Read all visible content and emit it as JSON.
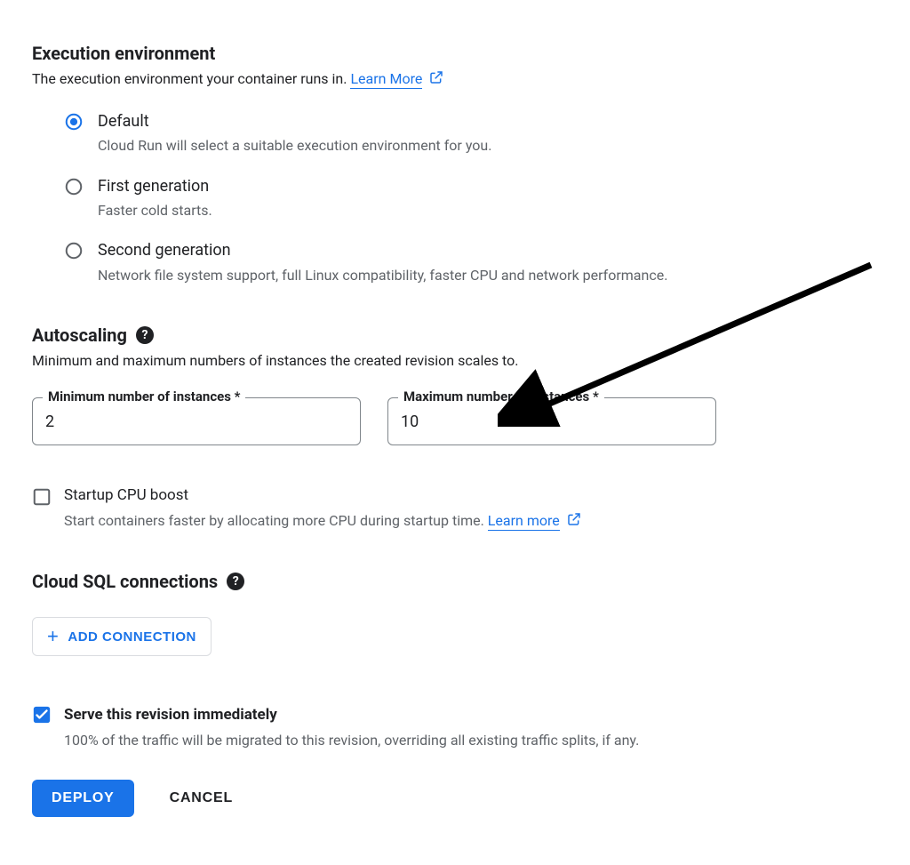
{
  "execution": {
    "title": "Execution environment",
    "desc": "The execution environment your container runs in. ",
    "learn": "Learn More",
    "options": [
      {
        "label": "Default",
        "sub": "Cloud Run will select a suitable execution environment for you.",
        "selected": true
      },
      {
        "label": "First generation",
        "sub": "Faster cold starts.",
        "selected": false
      },
      {
        "label": "Second generation",
        "sub": "Network file system support, full Linux compatibility, faster CPU and network performance.",
        "selected": false
      }
    ]
  },
  "autoscaling": {
    "title": "Autoscaling",
    "desc": "Minimum and maximum numbers of instances the created revision scales to.",
    "min_label": "Minimum number of instances *",
    "min_value": "2",
    "max_label": "Maximum number of instances *",
    "max_value": "10",
    "cpu_boost_label": "Startup CPU boost",
    "cpu_boost_sub": "Start containers faster by allocating more CPU during startup time. ",
    "cpu_boost_learn": "Learn more",
    "cpu_boost_checked": false
  },
  "cloudsql": {
    "title": "Cloud SQL connections",
    "add_button": "ADD CONNECTION"
  },
  "serve": {
    "label": "Serve this revision immediately",
    "sub": "100% of the traffic will be migrated to this revision, overriding all existing traffic splits, if any.",
    "checked": true
  },
  "footer": {
    "deploy": "DEPLOY",
    "cancel": "CANCEL"
  },
  "colors": {
    "primary": "#1a73e8",
    "text": "#202124",
    "muted": "#5f6368",
    "border": "#80868b"
  }
}
